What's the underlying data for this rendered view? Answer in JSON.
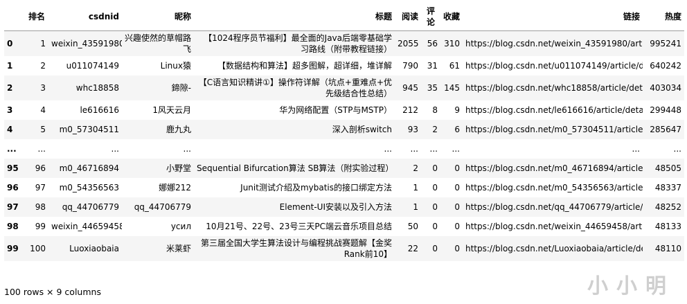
{
  "table": {
    "headers": [
      "",
      "排名",
      "csdnid",
      "昵称",
      "标题",
      "阅读",
      "评论",
      "收藏",
      "链接",
      "热度"
    ],
    "rows": [
      [
        "0",
        "1",
        "weixin_43591980",
        "兴趣使然的草帽路飞",
        "【1024程序员节福利】最全面的Java后端零基础学习路线（附带教程链接）",
        "2055",
        "56",
        "310",
        "https://blog.csdn.net/weixin_43591980/article/...",
        "995241"
      ],
      [
        "1",
        "2",
        "u011074149",
        "Linux猿",
        "【数据结构和算法】超多图解，超详细，堆详解",
        "790",
        "31",
        "61",
        "https://blog.csdn.net/u011074149/article/detai...",
        "640242"
      ],
      [
        "2",
        "3",
        "whc18858",
        "鍗隙-",
        "【C语言知识精讲①】操作符详解（坑点+重难点+优先级结合性总结）",
        "945",
        "35",
        "145",
        "https://blog.csdn.net/whc18858/article/details...",
        "403034"
      ],
      [
        "3",
        "4",
        "le616616",
        "1风天云月",
        "华为网络配置（STP与MSTP）",
        "212",
        "8",
        "9",
        "https://blog.csdn.net/le616616/article/details...",
        "299448"
      ],
      [
        "4",
        "5",
        "m0_57304511",
        "鹿九丸",
        "深入剖析switch",
        "93",
        "2",
        "6",
        "https://blog.csdn.net/m0_57304511/article/deta...",
        "285647"
      ],
      [
        "...",
        "...",
        "...",
        "...",
        "...",
        "...",
        "...",
        "...",
        "...",
        "..."
      ],
      [
        "95",
        "96",
        "m0_46716894",
        "小野堂",
        "Sequential Bifurcation算法 SB算法（附实验过程）",
        "2",
        "0",
        "0",
        "https://blog.csdn.net/m0_46716894/article/deta...",
        "48505"
      ],
      [
        "96",
        "97",
        "m0_54356563",
        "娜娜212",
        "Junit测试介绍及mybatis的接口绑定方法",
        "1",
        "0",
        "0",
        "https://blog.csdn.net/m0_54356563/article/deta...",
        "48337"
      ],
      [
        "97",
        "98",
        "qq_44706779",
        "qq_44706779",
        "Element-UI安装以及引入方法",
        "1",
        "0",
        "0",
        "https://blog.csdn.net/qq_44706779/article/deta...",
        "48252"
      ],
      [
        "98",
        "99",
        "weixin_44659458",
        "усил",
        "10月21号、22号、23号三天PC端云音乐项目总结",
        "50",
        "0",
        "0",
        "https://blog.csdn.net/weixin_44659458/article/...",
        "48133"
      ],
      [
        "99",
        "100",
        "Luoxiaobaia",
        "米莱虾",
        "第三届全国大学生算法设计与编程挑战赛题解【金奖Rank前10】",
        "22",
        "0",
        "0",
        "https://blog.csdn.net/Luoxiaobaia/article/deta...",
        "48110"
      ]
    ]
  },
  "footer": "100 rows × 9 columns",
  "watermark": "小小明"
}
